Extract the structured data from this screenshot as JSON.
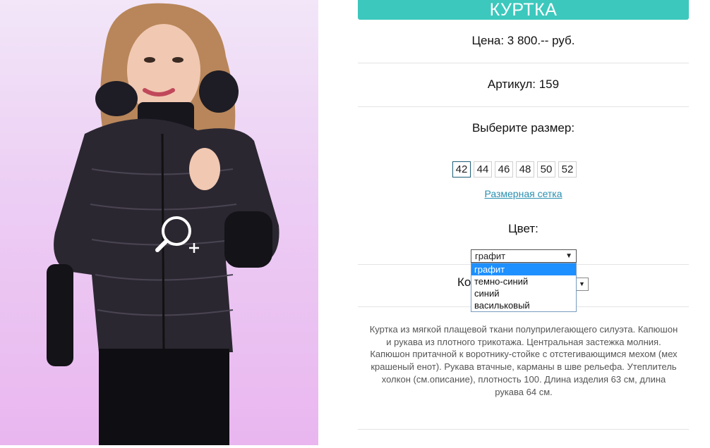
{
  "product": {
    "title": "КУРТКА",
    "price": "Цена: 3 800.-- руб.",
    "article": "Артикул: 159",
    "size_prompt": "Выберите размер:",
    "sizes": [
      "42",
      "44",
      "46",
      "48",
      "50",
      "52"
    ],
    "selected_size": "42",
    "size_chart_link": "Размерная сетка",
    "color_label": "Цвет:",
    "color_select": {
      "selected": "графит",
      "options": [
        "графит",
        "темно-синий",
        "синий",
        "васильковый"
      ]
    },
    "quantity_label": "Ко",
    "description": "Куртка из мягкой плащевой ткани полуприлегающего силуэта. Капюшон и рукава из плотного трикотажа. Центральная застежка молния. Капюшон притачной к воротнику-стойке с отстегивающимся мехом (мех крашеный енот). Рукава втачные, карманы в шве рельефа. Утеплитель холкон (см.описание), плотность 100. Длина изделия 63 см, длина рукава 64 см."
  },
  "icons": {
    "zoom": "zoom-in-icon"
  },
  "colors": {
    "accent": "#3cc8bd",
    "link": "#2a8fb0",
    "dropdown_highlight": "#1e90ff"
  }
}
